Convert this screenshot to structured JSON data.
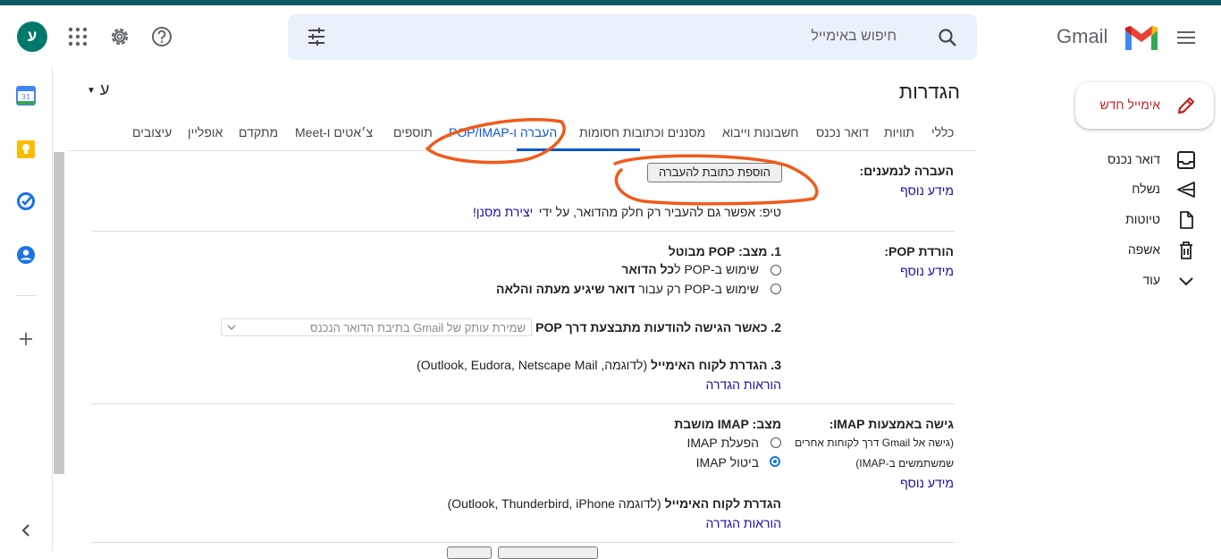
{
  "header": {
    "brand": "Gmail",
    "search_placeholder": "חיפוש באימייל",
    "avatar_letter": "ע"
  },
  "colors": {
    "accent": "#0b57d0",
    "compose_red": "#c5221f",
    "avatar_bg": "#00796b",
    "annotation": "#f05a1a"
  },
  "compose": {
    "label": "אימייל חדש"
  },
  "nav": [
    {
      "label": "דואר נכנס",
      "icon": "inbox-icon"
    },
    {
      "label": "נשלח",
      "icon": "send-icon"
    },
    {
      "label": "טיוטות",
      "icon": "draft-icon"
    },
    {
      "label": "אשפה",
      "icon": "trash-icon"
    },
    {
      "label": "עוד",
      "icon": "chevron-down-icon"
    }
  ],
  "side_panel_icons": [
    "calendar-icon",
    "keep-icon",
    "tasks-icon",
    "contacts-icon",
    "add-icon",
    "collapse-icon"
  ],
  "settings": {
    "title": "הגדרות",
    "lang": "ע",
    "tabs": [
      "כללי",
      "תוויות",
      "דואר נכנס",
      "חשבונות וייבוא",
      "מסננים וכתובות חסומות",
      "העברה ו-POP/IMAP",
      "תוספים",
      "צ׳אטים ו-Meet",
      "מתקדם",
      "אופליין",
      "עיצובים"
    ],
    "active_tab": "העברה ו-POP/IMAP"
  },
  "forwarding": {
    "label": "העברה לנמענים:",
    "learn_more": "מידע נוסף",
    "add_button": "הוספת כתובת להעברה",
    "tip_prefix": "טיפ: אפשר גם להעביר רק חלק מהדואר, על ידי",
    "tip_link": "יצירת מסנן!"
  },
  "pop": {
    "label": "הורדת POP:",
    "learn_more": "מידע נוסף",
    "status": "1. מצב: POP מבוטל",
    "option_all_a": "שימוש ב-POP ל",
    "option_all_b": "כל הדואר",
    "option_new_a": "שימוש ב-POP רק עבור ",
    "option_new_b": "דואר שיגיע מעתה והלאה",
    "when_accessed": "2. כאשר הגישה להודעות מתבצעת דרך POP",
    "when_accessed_value": "שמירת עותק של Gmail בתיבת הדואר הנכנס",
    "client_a": "3. הגדרת לקוח האימייל",
    "client_b": " (לדוגמה, Outlook, Eudora, Netscape Mail)",
    "instructions": "הוראות הגדרה"
  },
  "imap": {
    "label": "גישה באמצעות IMAP:",
    "desc1": "(גישה אל Gmail דרך לקוחות אחרים",
    "desc2": "שמשתמשים ב-IMAP)",
    "learn_more": "מידע נוסף",
    "status": "מצב: IMAP מושבת",
    "enable": "הפעלת IMAP",
    "disable": "ביטול IMAP",
    "disable_selected": true,
    "client_a": "הגדרת לקוח האימייל",
    "client_b": " (לדוגמה Outlook, Thunderbird, iPhone)",
    "instructions": "הוראות הגדרה"
  }
}
